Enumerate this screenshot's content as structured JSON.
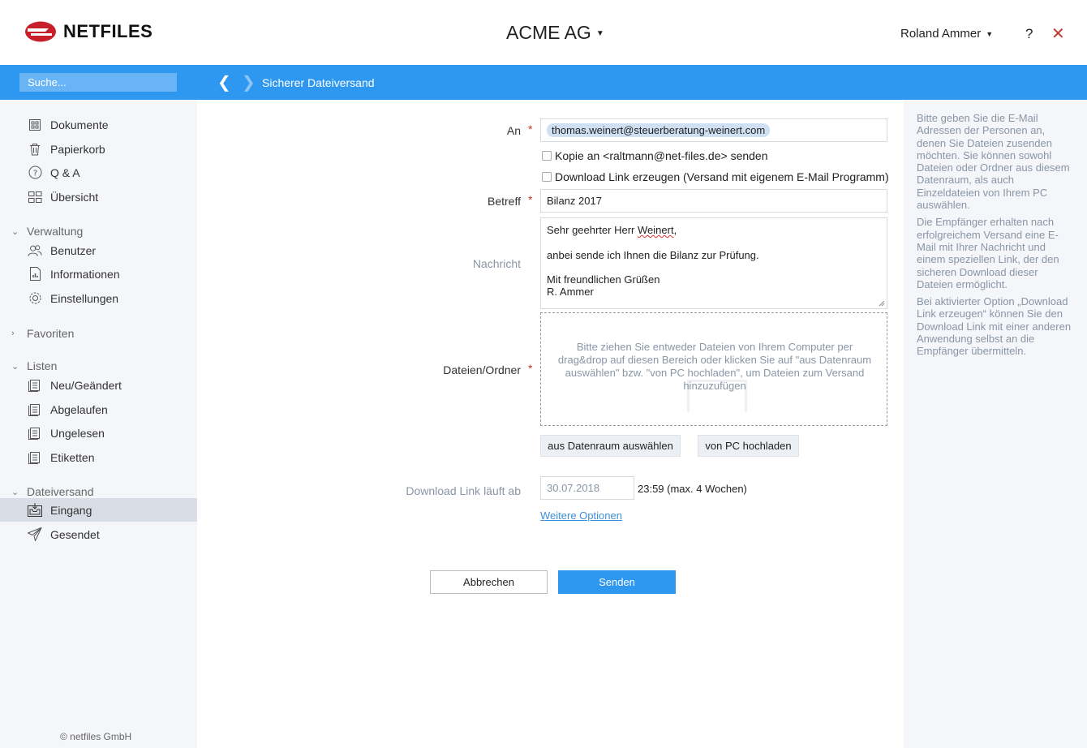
{
  "header": {
    "logo_text": "NETFILES",
    "company": "ACME AG",
    "user": "Roland Ammer",
    "help": "?",
    "close": "✕"
  },
  "toolbar": {
    "search_placeholder": "Suche...",
    "breadcrumb": "Sicherer Dateiversand"
  },
  "sidebar": {
    "top_items": [
      {
        "label": "Dokumente",
        "icon": "documents-icon"
      },
      {
        "label": "Papierkorb",
        "icon": "trash-icon"
      },
      {
        "label": "Q & A",
        "icon": "question-icon"
      },
      {
        "label": "Übersicht",
        "icon": "grid-icon"
      }
    ],
    "sections": {
      "verwaltung": "Verwaltung",
      "favoriten": "Favoriten",
      "listen": "Listen",
      "dateiversand": "Dateiversand"
    },
    "verwaltung_items": [
      {
        "label": "Benutzer",
        "icon": "users-icon"
      },
      {
        "label": "Informationen",
        "icon": "info-doc-icon"
      },
      {
        "label": "Einstellungen",
        "icon": "gear-icon"
      }
    ],
    "listen_items": [
      {
        "label": "Neu/Geändert",
        "icon": "list-icon"
      },
      {
        "label": "Abgelaufen",
        "icon": "list-icon"
      },
      {
        "label": "Ungelesen",
        "icon": "list-icon"
      },
      {
        "label": "Etiketten",
        "icon": "list-icon"
      }
    ],
    "dateiversand_items": [
      {
        "label": "Eingang",
        "icon": "inbox-icon",
        "active": true
      },
      {
        "label": "Gesendet",
        "icon": "paper-plane-icon"
      }
    ],
    "footer": "© netfiles GmbH"
  },
  "form": {
    "to_label": "An",
    "to_value": "thomas.weinert@steuerberatung-weinert.com",
    "copy_label": "Kopie an <raltmann@net-files.de> senden",
    "download_link_label": "Download Link erzeugen (Versand mit eigenem E-Mail Programm)",
    "subject_label": "Betreff",
    "subject_value": "Bilanz 2017",
    "message_label": "Nachricht",
    "message_lines": {
      "l1a": "Sehr geehrter Herr ",
      "l1b": "Weinert",
      "l1c": ",",
      "l2": "anbei sende ich Ihnen die Bilanz zur Prüfung.",
      "l3": "Mit freundlichen Grüßen",
      "l4": "R. Ammer"
    },
    "files_label": "Dateien/Ordner",
    "dropzone_text": "Bitte ziehen Sie entweder Dateien von Ihrem Computer per drag&drop auf diesen Bereich oder klicken Sie auf \"aus Datenraum auswählen\" bzw. \"von PC hochladen\", um Dateien zum Versand hinzuzufügen",
    "btn_datenraum": "aus Datenraum auswählen",
    "btn_pc": "von PC hochladen",
    "expiry_label": "Download Link läuft ab",
    "expiry_date": "30.07.2018",
    "expiry_time": "23:59 (max. 4 Wochen)",
    "more_options": "Weitere Optionen",
    "cancel": "Abbrechen",
    "send": "Senden",
    "required_mark": "*"
  },
  "help_panel": {
    "p1": "Bitte geben Sie die E-Mail Adressen der Personen an, denen Sie Dateien zusenden möchten. Sie können sowohl Dateien oder Ordner aus diesem Datenraum, als auch Einzeldateien von Ihrem PC auswählen.",
    "p2": "Die Empfänger erhalten nach erfolgreichem Versand eine E-Mail mit Ihrer Nachricht und einem speziellen Link, der den sicheren Download dieser Dateien ermöglicht.",
    "p3": "Bei aktivierter Option „Download Link erzeugen“ können Sie den Download Link mit einer anderen Anwendung selbst an die Empfänger übermitteln."
  },
  "colors": {
    "accent": "#2e98f0",
    "required": "#c0392b",
    "sidebar_bg": "#f4f6f9"
  }
}
